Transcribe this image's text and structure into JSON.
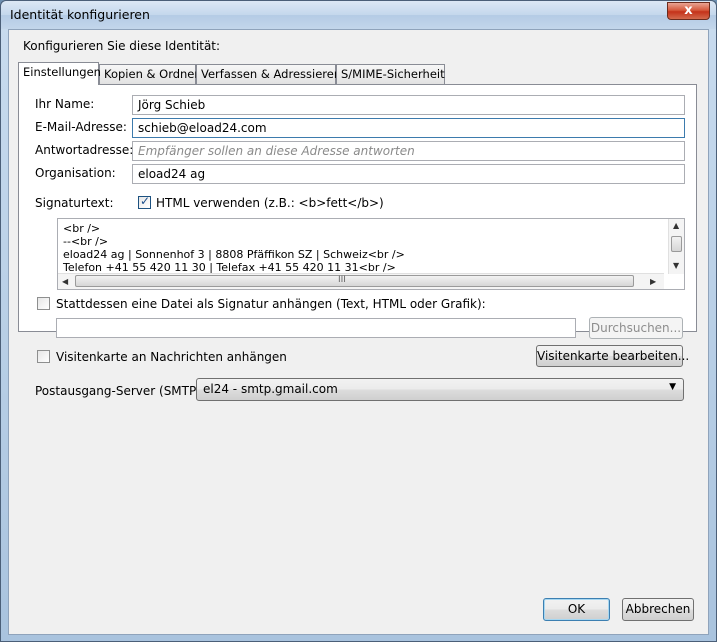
{
  "window": {
    "title": "Identität konfigurieren",
    "close": "x"
  },
  "heading": "Konfigurieren Sie diese Identität:",
  "tabs": [
    {
      "label": "Einstellungen"
    },
    {
      "label": "Kopien & Ordner"
    },
    {
      "label": "Verfassen & Adressieren"
    },
    {
      "label": "S/MIME-Sicherheit"
    }
  ],
  "form": {
    "name": {
      "label": "Ihr Name:",
      "value": "Jörg Schieb"
    },
    "email": {
      "label": "E-Mail-Adresse:",
      "value": "schieb@eload24.com"
    },
    "reply": {
      "label": "Antwortadresse:",
      "placeholder": "Empfänger sollen an diese Adresse antworten"
    },
    "org": {
      "label": "Organisation:",
      "value": "eload24 ag"
    },
    "signature": {
      "label": "Signaturtext:",
      "html_checkbox": "HTML verwenden (z.B.: <b>fett</b>)",
      "html_checked": true,
      "lines": [
        "<br />",
        "--<br />",
        "eload24 ag | Sonnenhof 3 | 8808 Pfäffikon SZ | Schweiz<br />",
        "Telefon +41 55 420 11 30 | Telefax +41 55 420 11 31<br />"
      ],
      "hscroll_grip": "III"
    },
    "attach_file": {
      "label": "Stattdessen eine Datei als Signatur anhängen (Text, HTML oder Grafik):",
      "checked": false,
      "path": "",
      "browse": "Durchsuchen..."
    },
    "vcard": {
      "label": "Visitenkarte an Nachrichten anhängen",
      "checked": false,
      "edit": "Visitenkarte bearbeiten..."
    },
    "smtp": {
      "label": "Postausgang-Server (SMTP):",
      "value": "el24 - smtp.gmail.com"
    }
  },
  "buttons": {
    "ok": "OK",
    "cancel": "Abbrechen"
  }
}
